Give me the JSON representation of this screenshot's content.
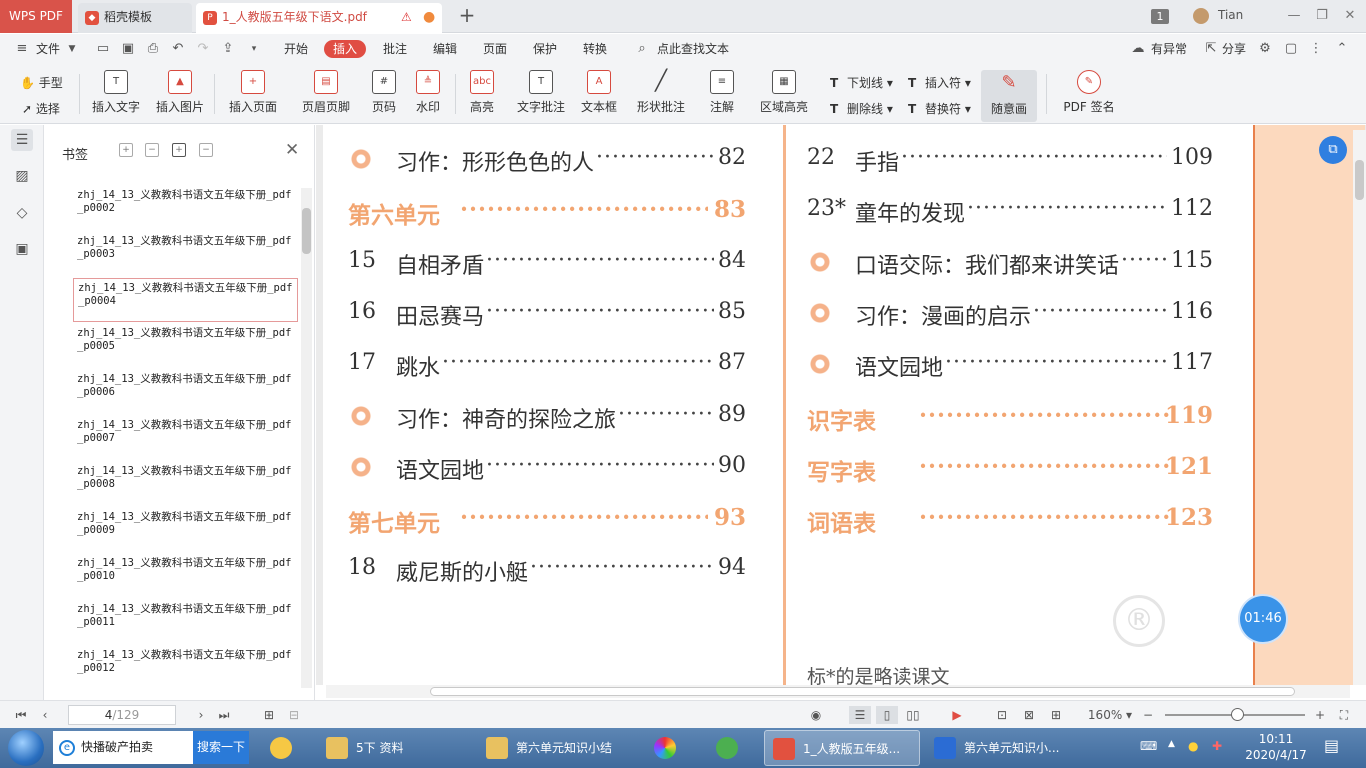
{
  "tabs": {
    "app": "WPS PDF",
    "templates": "稻壳模板",
    "document": "1_人教版五年级下语文.pdf",
    "new_tab": "+"
  },
  "titlebar": {
    "window_count": "1",
    "user": "Tian"
  },
  "menu": {
    "file": "文件",
    "items": [
      "开始",
      "插入",
      "批注",
      "编辑",
      "页面",
      "保护",
      "转换"
    ],
    "search": "点此查找文本",
    "anomaly": "有异常",
    "share": "分享"
  },
  "toolbar": {
    "hand": "手型",
    "select": "选择",
    "insert_text": "插入文字",
    "insert_image": "插入图片",
    "insert_page": "插入页面",
    "header_footer": "页眉页脚",
    "page_number": "页码",
    "watermark": "水印",
    "highlight": "高亮",
    "text_comment": "文字批注",
    "textbox": "文本框",
    "shape_comment": "形状批注",
    "note": "注解",
    "area_highlight": "区域高亮",
    "underline": "下划线",
    "strikethrough": "删除线",
    "insert_mark": "插入符",
    "replace_mark": "替换符",
    "freehand": "随意画",
    "pdf_sign": "PDF 签名"
  },
  "bookmarks": {
    "title": "书签",
    "items": [
      "zhj_14_13_义教教科书语文五年级下册_pdf_p0002",
      "zhj_14_13_义教教科书语文五年级下册_pdf_p0003",
      "zhj_14_13_义教教科书语文五年级下册_pdf_p0004",
      "zhj_14_13_义教教科书语文五年级下册_pdf_p0005",
      "zhj_14_13_义教教科书语文五年级下册_pdf_p0006",
      "zhj_14_13_义教教科书语文五年级下册_pdf_p0007",
      "zhj_14_13_义教教科书语文五年级下册_pdf_p0008",
      "zhj_14_13_义教教科书语文五年级下册_pdf_p0009",
      "zhj_14_13_义教教科书语文五年级下册_pdf_p0010",
      "zhj_14_13_义教教科书语文五年级下册_pdf_p0011",
      "zhj_14_13_义教教科书语文五年级下册_pdf_p0012"
    ],
    "selected_index": 2
  },
  "toc_left": [
    {
      "num": "",
      "title": "习作：形形色色的人",
      "page": "82",
      "flower": true
    },
    {
      "unit": "第六单元",
      "page": "83"
    },
    {
      "num": "15",
      "title": "自相矛盾",
      "page": "84"
    },
    {
      "num": "16",
      "title": "田忌赛马",
      "page": "85"
    },
    {
      "num": "17",
      "title": "跳水",
      "page": "87"
    },
    {
      "num": "",
      "title": "习作：神奇的探险之旅",
      "page": "89",
      "flower": true
    },
    {
      "num": "",
      "title": "语文园地",
      "page": "90",
      "flower": true
    },
    {
      "unit": "第七单元",
      "page": "93"
    },
    {
      "num": "18",
      "title": "威尼斯的小艇",
      "page": "94"
    }
  ],
  "toc_right": [
    {
      "num": "22",
      "title": "手指",
      "page": "109"
    },
    {
      "num": "23*",
      "title": "童年的发现",
      "page": "112"
    },
    {
      "num": "",
      "title": "口语交际：我们都来讲笑话",
      "page": "115",
      "flower": true
    },
    {
      "num": "",
      "title": "习作：漫画的启示",
      "page": "116",
      "flower": true
    },
    {
      "num": "",
      "title": "语文园地",
      "page": "117",
      "flower": true
    },
    {
      "unit": "识字表",
      "page": "119"
    },
    {
      "unit": "写字表",
      "page": "121"
    },
    {
      "unit": "词语表",
      "page": "123"
    }
  ],
  "note": "标*的是略读课文",
  "timer": "01:46",
  "status": {
    "page": "4",
    "total": "/129",
    "zoom": "160%"
  },
  "taskbar": {
    "search_text": "快播破产拍卖",
    "search_button": "搜索一下",
    "tasks": [
      "5下  资料",
      "第六单元知识小结",
      "1_人教版五年级...",
      "第六单元知识小..."
    ],
    "time": "10:11",
    "date": "2020/4/17"
  },
  "colors": {
    "accent": "#e04d43",
    "unit_orange": "#f2a571",
    "margin": "#fcd9be"
  }
}
